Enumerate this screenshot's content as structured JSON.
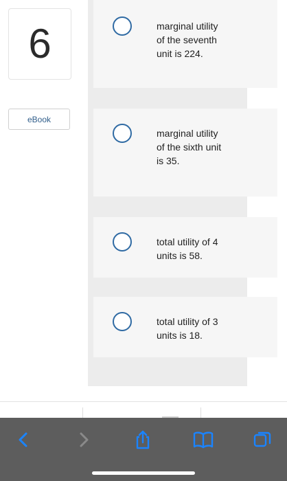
{
  "question": {
    "number": "6",
    "ebook_label": "eBook"
  },
  "options": [
    {
      "text": "marginal utility of the seventh unit is 224."
    },
    {
      "text": "marginal utility of the sixth unit is 35."
    },
    {
      "text": "total utility of 4 units is 58."
    },
    {
      "text": "total utility of 3 units is 18."
    }
  ],
  "toolbar": {
    "icons": [
      "back-icon",
      "forward-icon",
      "share-icon",
      "bookmarks-icon",
      "tabs-icon"
    ],
    "accent_color": "#1a84ff",
    "disabled_color": "#8a8a8a",
    "background_color": "#5d5d5d"
  },
  "colors": {
    "radio_border": "#2f6aa3",
    "ebook_text": "#2f5d8a"
  }
}
